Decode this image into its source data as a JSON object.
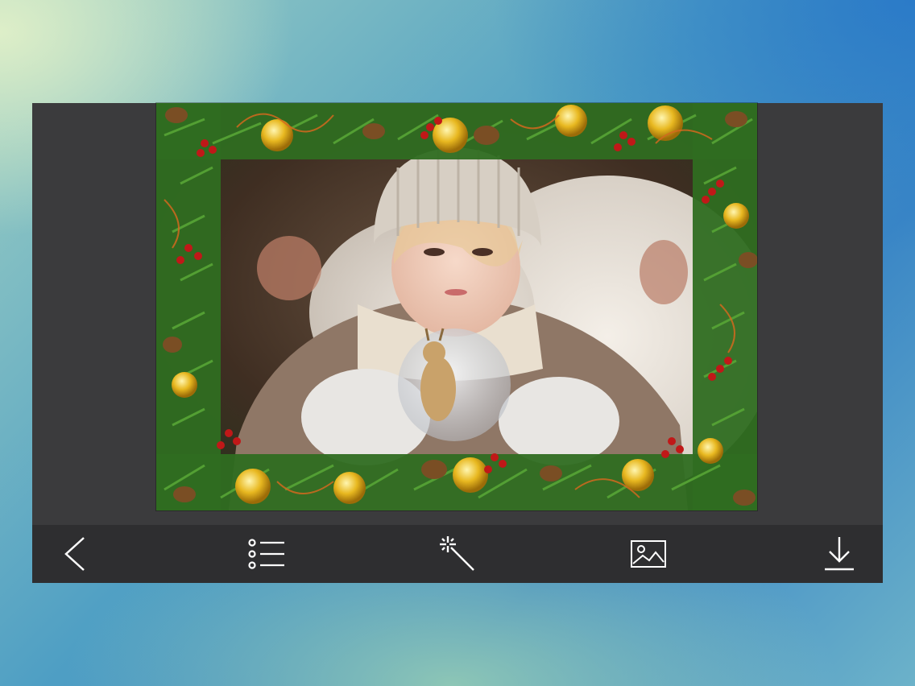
{
  "app": {
    "canvas_color": "#3b3b3d",
    "toolbar_color": "#2e2e30"
  },
  "photo": {
    "frame_theme": "christmas-garland",
    "subject": "child-with-snow-globe"
  },
  "toolbar": {
    "buttons": [
      {
        "icon": "chevron-left-icon",
        "action": "back"
      },
      {
        "icon": "list-icon",
        "action": "frames"
      },
      {
        "icon": "magic-wand-icon",
        "action": "effects"
      },
      {
        "icon": "image-icon",
        "action": "gallery"
      },
      {
        "icon": "download-icon",
        "action": "save"
      }
    ],
    "icon_color": "#ffffff"
  }
}
